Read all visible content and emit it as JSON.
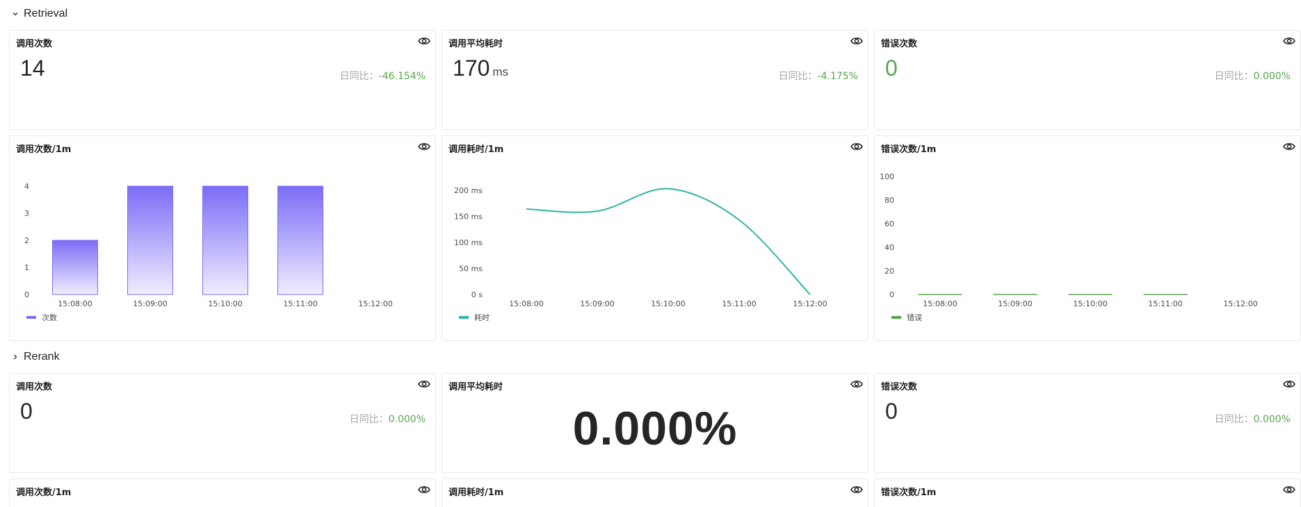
{
  "sections": [
    {
      "title": "Retrieval",
      "expanded": true
    },
    {
      "title": "Rerank",
      "expanded": false
    }
  ],
  "retrieval": {
    "calls": {
      "title": "调用次数",
      "value": "14",
      "dod_label": "日同比：",
      "dod_value": "-46.154%"
    },
    "avg_latency": {
      "title": "调用平均耗时",
      "value": "170",
      "unit": "ms",
      "dod_label": "日同比：",
      "dod_value": "-4.175%"
    },
    "errors": {
      "title": "错误次数",
      "value": "0",
      "dod_label": "日同比：",
      "dod_value": "0.000%"
    },
    "calls_chart_title": "调用次数/1m",
    "latency_chart_title": "调用耗时/1m",
    "errors_chart_title": "错误次数/1m"
  },
  "rerank": {
    "calls": {
      "title": "调用次数",
      "value": "0",
      "dod_label": "日同比：",
      "dod_value": "0.000%"
    },
    "avg_latency": {
      "title": "调用平均耗时",
      "value": "0.000%"
    },
    "errors": {
      "title": "错误次数",
      "value": "0",
      "dod_label": "日同比：",
      "dod_value": "0.000%"
    },
    "calls_chart_title": "调用次数/1m",
    "latency_chart_title": "调用耗时/1m",
    "errors_chart_title": "错误次数/1m"
  },
  "colors": {
    "bar": "#7b6cf6",
    "line": "#2eb3a7",
    "error": "#56a64b",
    "positive": "#56a64b"
  },
  "chart_data": [
    {
      "type": "bar",
      "title": "调用次数/1m",
      "categories": [
        "15:08:00",
        "15:09:00",
        "15:10:00",
        "15:11:00",
        "15:12:00"
      ],
      "series": [
        {
          "name": "次数",
          "values": [
            2,
            4,
            4,
            4,
            0
          ]
        }
      ],
      "yticks": [
        "0",
        "1",
        "2",
        "3",
        "4"
      ],
      "ylim": [
        0,
        4
      ],
      "legend": "bottom-left"
    },
    {
      "type": "line",
      "title": "调用耗时/1m",
      "categories": [
        "15:08:00",
        "15:09:00",
        "15:10:00",
        "15:11:00",
        "15:12:00"
      ],
      "series": [
        {
          "name": "耗时",
          "values": [
            164,
            160,
            203,
            143,
            0
          ]
        }
      ],
      "yticks": [
        "0 s",
        "50 ms",
        "100 ms",
        "150 ms",
        "200 ms"
      ],
      "ylim": [
        0,
        200
      ],
      "legend": "bottom-left"
    },
    {
      "type": "bar",
      "title": "错误次数/1m",
      "categories": [
        "15:08:00",
        "15:09:00",
        "15:10:00",
        "15:11:00",
        "15:12:00"
      ],
      "series": [
        {
          "name": "错误",
          "values": [
            0,
            0,
            0,
            0,
            0
          ]
        }
      ],
      "yticks": [
        "0",
        "20",
        "40",
        "60",
        "80",
        "100"
      ],
      "ylim": [
        0,
        100
      ],
      "legend": "bottom-left"
    }
  ]
}
